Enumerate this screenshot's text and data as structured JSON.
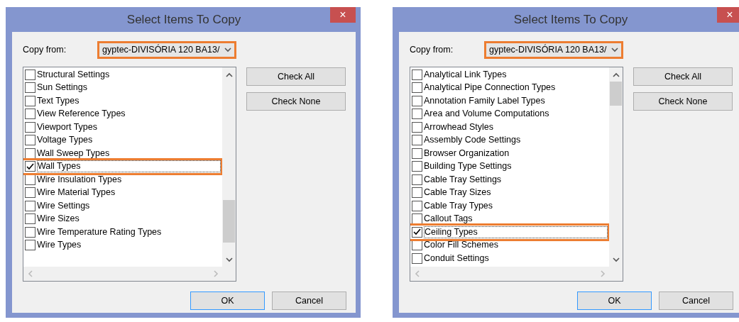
{
  "dialogs": [
    {
      "title": "Select Items To Copy",
      "close": "×",
      "copy_from_label": "Copy from:",
      "copy_from": {
        "value": "gyptec-DIVISÓRIA 120 BA13/",
        "highlighted": true
      },
      "scrolled_to_end": true,
      "items": [
        {
          "label": "Structural Settings",
          "checked": false,
          "selected": false
        },
        {
          "label": "Sun Settings",
          "checked": false,
          "selected": false
        },
        {
          "label": "Text Types",
          "checked": false,
          "selected": false
        },
        {
          "label": "View Reference Types",
          "checked": false,
          "selected": false
        },
        {
          "label": "Viewport Types",
          "checked": false,
          "selected": false
        },
        {
          "label": "Voltage Types",
          "checked": false,
          "selected": false
        },
        {
          "label": "Wall Sweep Types",
          "checked": false,
          "selected": false
        },
        {
          "label": "Wall Types",
          "checked": true,
          "selected": true
        },
        {
          "label": "Wire Insulation Types",
          "checked": false,
          "selected": false
        },
        {
          "label": "Wire Material Types",
          "checked": false,
          "selected": false
        },
        {
          "label": "Wire Settings",
          "checked": false,
          "selected": false
        },
        {
          "label": "Wire Sizes",
          "checked": false,
          "selected": false
        },
        {
          "label": "Wire Temperature Rating Types",
          "checked": false,
          "selected": false
        },
        {
          "label": "Wire Types",
          "checked": false,
          "selected": false
        }
      ],
      "side_buttons": [
        "Check All",
        "Check None"
      ],
      "ok": "OK",
      "cancel": "Cancel"
    },
    {
      "title": "Select Items To Copy",
      "close": "×",
      "copy_from_label": "Copy from:",
      "copy_from": {
        "value": "gyptec-DIVISÓRIA 120 BA13/",
        "highlighted": true
      },
      "scrolled_to_end": false,
      "items": [
        {
          "label": "Analytical Link Types",
          "checked": false,
          "selected": false
        },
        {
          "label": "Analytical Pipe Connection Types",
          "checked": false,
          "selected": false
        },
        {
          "label": "Annotation Family Label Types",
          "checked": false,
          "selected": false
        },
        {
          "label": "Area and Volume Computations",
          "checked": false,
          "selected": false
        },
        {
          "label": "Arrowhead Styles",
          "checked": false,
          "selected": false
        },
        {
          "label": "Assembly Code Settings",
          "checked": false,
          "selected": false
        },
        {
          "label": "Browser Organization",
          "checked": false,
          "selected": false
        },
        {
          "label": "Building Type Settings",
          "checked": false,
          "selected": false
        },
        {
          "label": "Cable Tray Settings",
          "checked": false,
          "selected": false
        },
        {
          "label": "Cable Tray Sizes",
          "checked": false,
          "selected": false
        },
        {
          "label": "Cable Tray Types",
          "checked": false,
          "selected": false
        },
        {
          "label": "Callout Tags",
          "checked": false,
          "selected": false
        },
        {
          "label": "Ceiling Types",
          "checked": true,
          "selected": true
        },
        {
          "label": "Color Fill Schemes",
          "checked": false,
          "selected": false
        },
        {
          "label": "Conduit Settings",
          "checked": false,
          "selected": false
        }
      ],
      "side_buttons": [
        "Check All",
        "Check None"
      ],
      "ok": "OK",
      "cancel": "Cancel"
    }
  ]
}
